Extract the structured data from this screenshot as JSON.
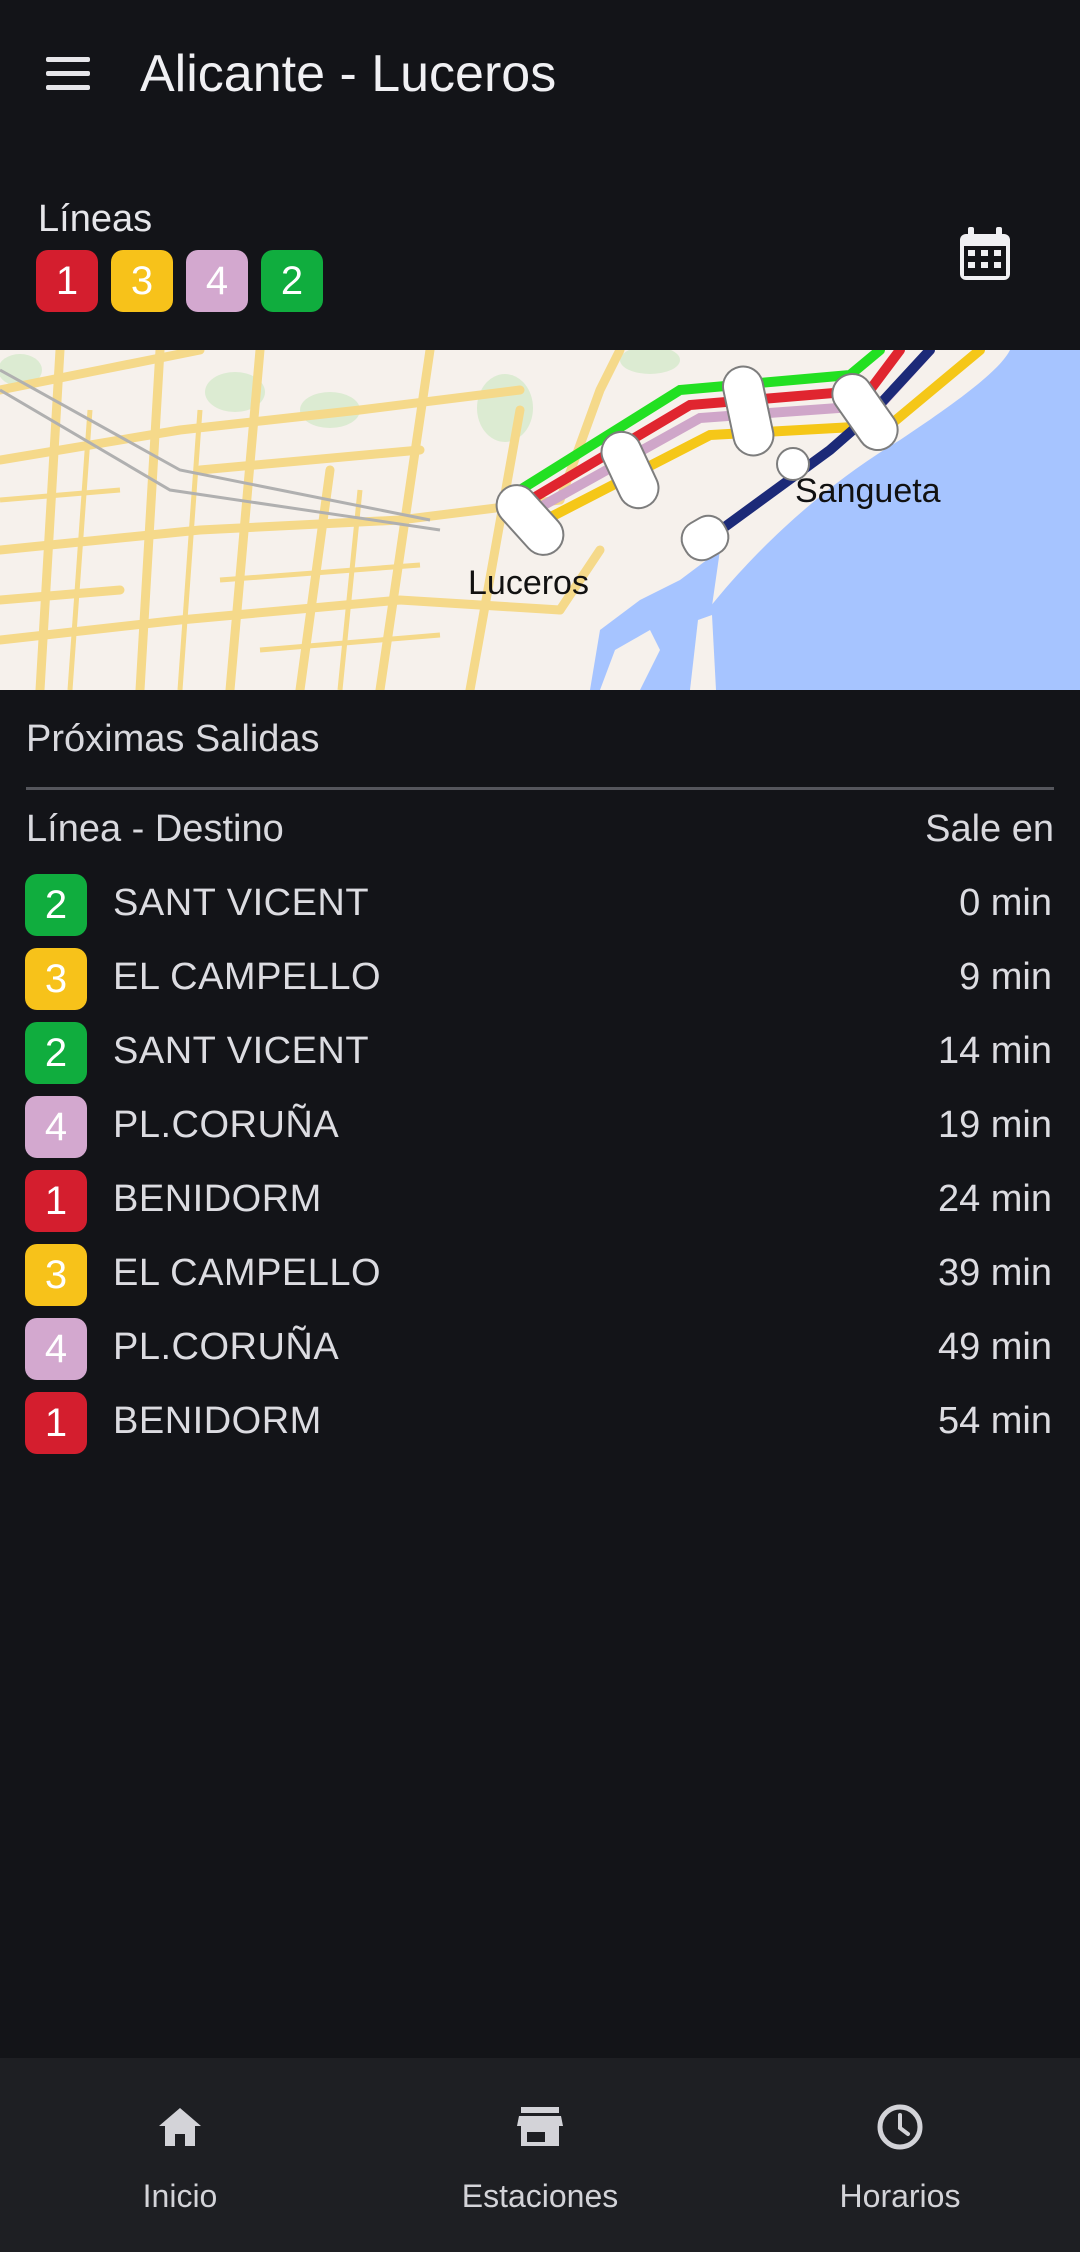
{
  "header": {
    "title": "Alicante - Luceros",
    "menu_icon": "menu-icon"
  },
  "lines": {
    "label": "Líneas",
    "badges": [
      {
        "number": "1",
        "color": "#d41e2e"
      },
      {
        "number": "3",
        "color": "#f7c21a"
      },
      {
        "number": "4",
        "color": "#d3a8cf"
      },
      {
        "number": "2",
        "color": "#10ad3e"
      }
    ],
    "calendar_icon": "calendar-icon"
  },
  "map": {
    "labels": {
      "station": "Luceros",
      "neighbor": "Sangueta"
    },
    "route_colors": {
      "line2": "#22e022",
      "line1": "#e0252f",
      "line4": "#cfa6c9",
      "line3": "#f5c718",
      "line_dark": "#1c2a78"
    },
    "sea_color": "#a6c4ff"
  },
  "departures": {
    "title": "Próximas Salidas",
    "col_left": "Línea - Destino",
    "col_right": "Sale en",
    "rows": [
      {
        "line": "2",
        "color": "#10ad3e",
        "destination": "SANT VICENT",
        "time": "0 min"
      },
      {
        "line": "3",
        "color": "#f7c21a",
        "destination": "EL CAMPELLO",
        "time": "9 min"
      },
      {
        "line": "2",
        "color": "#10ad3e",
        "destination": "SANT VICENT",
        "time": "14 min"
      },
      {
        "line": "4",
        "color": "#d3a8cf",
        "destination": "PL.CORUÑA",
        "time": "19 min"
      },
      {
        "line": "1",
        "color": "#d41e2e",
        "destination": "BENIDORM",
        "time": "24 min"
      },
      {
        "line": "3",
        "color": "#f7c21a",
        "destination": "EL CAMPELLO",
        "time": "39 min"
      },
      {
        "line": "4",
        "color": "#d3a8cf",
        "destination": "PL.CORUÑA",
        "time": "49 min"
      },
      {
        "line": "1",
        "color": "#d41e2e",
        "destination": "BENIDORM",
        "time": "54 min"
      }
    ]
  },
  "nav": {
    "items": [
      {
        "label": "Inicio",
        "icon": "home-icon"
      },
      {
        "label": "Estaciones",
        "icon": "store-icon"
      },
      {
        "label": "Horarios",
        "icon": "clock-icon"
      }
    ]
  }
}
